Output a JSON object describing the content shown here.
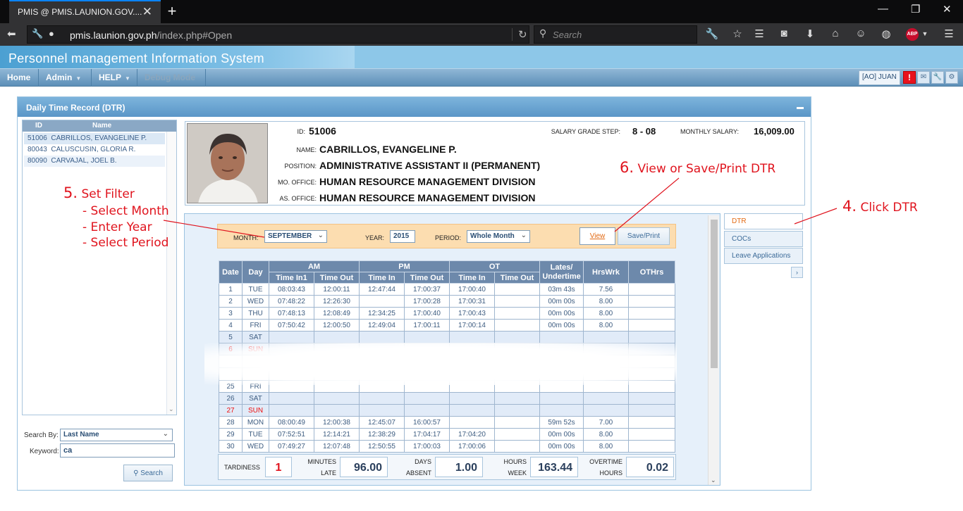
{
  "browser": {
    "tab_title": "PMIS @ PMIS.LAUNION.GOV....",
    "url_host": "pmis.launion.gov.ph",
    "url_path": "/index.php#Open",
    "search_placeholder": "Search",
    "abp_label": "ABP"
  },
  "app": {
    "title": "Personnel management Information System",
    "menu": [
      {
        "label": "Home"
      },
      {
        "label": "Admin"
      },
      {
        "label": "HELP"
      },
      {
        "label": "Debug Mode"
      }
    ],
    "user": "[AO] JUAN",
    "alert": "!"
  },
  "panel": {
    "title": "Daily Time Record (DTR)"
  },
  "employee_list": {
    "headers": {
      "id": "ID",
      "name": "Name"
    },
    "rows": [
      {
        "id": "51006",
        "name": "CABRILLOS, EVANGELINE P."
      },
      {
        "id": "80043",
        "name": "CALUSCUSIN, GLORIA R."
      },
      {
        "id": "80090",
        "name": "CARVAJAL, JOEL B."
      }
    ]
  },
  "search": {
    "by_label": "Search By:",
    "by_value": "Last Name",
    "keyword_label": "Keyword:",
    "keyword_value": "ca",
    "button": "Search"
  },
  "employee": {
    "id_label": "ID:",
    "id": "51006",
    "sg_label": "SALARY GRADE STEP:",
    "sg": "8 - 08",
    "salary_label": "MONTHLY SALARY:",
    "salary": "16,009.00",
    "name_label": "NAME:",
    "name": "CABRILLOS, EVANGELINE P.",
    "position_label": "POSITION:",
    "position": "ADMINISTRATIVE ASSISTANT II (PERMANENT)",
    "mo_label": "MO. OFFICE:",
    "mo_office": "HUMAN RESOURCE MANAGEMENT DIVISION",
    "as_label": "AS. OFFICE:",
    "as_office": "HUMAN RESOURCE MANAGEMENT DIVISION"
  },
  "filter": {
    "month_label": "MONTH:",
    "month": "SEPTEMBER",
    "year_label": "YEAR:",
    "year": "2015",
    "period_label": "PERIOD:",
    "period": "Whole Month",
    "view_button": "View",
    "save_button": "Save/Print"
  },
  "side_tabs": [
    {
      "label": "DTR"
    },
    {
      "label": "COCs"
    },
    {
      "label": "Leave Applications"
    }
  ],
  "side_more": "›",
  "table": {
    "h_date": "Date",
    "h_day": "Day",
    "h_am": "AM",
    "h_pm": "PM",
    "h_ot": "OT",
    "h_lates": "Lates/ Undertime",
    "h_hrs": "HrsWrk",
    "h_ot_hrs": "OTHrs",
    "h_in1": "Time In1",
    "h_out1": "Time Out",
    "h_in2": "Time In",
    "h_out2": "Time Out",
    "h_in3": "Time In",
    "h_out3": "Time Out",
    "rows": [
      {
        "d": "1",
        "day": "TUE",
        "c": [
          "08:03:43",
          "12:00:11",
          "12:47:44",
          "17:00:37",
          "17:00:40",
          "",
          "03m 43s",
          "7.56",
          ""
        ]
      },
      {
        "d": "2",
        "day": "WED",
        "c": [
          "07:48:22",
          "12:26:30",
          "",
          "17:00:28",
          "17:00:31",
          "",
          "00m 00s",
          "8.00",
          ""
        ]
      },
      {
        "d": "3",
        "day": "THU",
        "c": [
          "07:48:13",
          "12:08:49",
          "12:34:25",
          "17:00:40",
          "17:00:43",
          "",
          "00m 00s",
          "8.00",
          ""
        ]
      },
      {
        "d": "4",
        "day": "FRI",
        "c": [
          "07:50:42",
          "12:00:50",
          "12:49:04",
          "17:00:11",
          "17:00:14",
          "",
          "00m 00s",
          "8.00",
          ""
        ]
      },
      {
        "d": "5",
        "day": "SAT",
        "c": [
          "",
          "",
          "",
          "",
          "",
          "",
          "",
          "",
          ""
        ]
      },
      {
        "d": "6",
        "day": "SUN",
        "c": [
          "",
          "",
          "",
          "",
          "",
          "",
          "",
          "",
          ""
        ]
      },
      {
        "d": "",
        "day": "",
        "c": [
          "",
          "",
          "",
          "",
          "",
          "",
          "",
          "",
          ""
        ]
      },
      {
        "d": "",
        "day": "",
        "c": [
          "",
          "",
          "",
          "",
          "",
          "",
          "",
          "",
          ""
        ]
      },
      {
        "d": "25",
        "day": "FRI",
        "c": [
          "",
          "",
          "",
          "",
          "",
          "",
          "",
          "",
          ""
        ]
      },
      {
        "d": "26",
        "day": "SAT",
        "c": [
          "",
          "",
          "",
          "",
          "",
          "",
          "",
          "",
          ""
        ]
      },
      {
        "d": "27",
        "day": "SUN",
        "c": [
          "",
          "",
          "",
          "",
          "",
          "",
          "",
          "",
          ""
        ]
      },
      {
        "d": "28",
        "day": "MON",
        "c": [
          "08:00:49",
          "12:00:38",
          "12:45:07",
          "16:00:57",
          "",
          "",
          "59m 52s",
          "7.00",
          ""
        ]
      },
      {
        "d": "29",
        "day": "TUE",
        "c": [
          "07:52:51",
          "12:14:21",
          "12:38:29",
          "17:04:17",
          "17:04:20",
          "",
          "00m 00s",
          "8.00",
          ""
        ]
      },
      {
        "d": "30",
        "day": "WED",
        "c": [
          "07:49:27",
          "12:07:48",
          "12:50:55",
          "17:00:03",
          "17:00:06",
          "",
          "00m 00s",
          "8.00",
          ""
        ]
      }
    ]
  },
  "summary": {
    "tardiness_label": "TARDINESS",
    "tardiness": "1",
    "minutes_label_1": "MINUTES",
    "minutes_label_2": "LATE",
    "minutes": "96.00",
    "days_label_1": "DAYS",
    "days_label_2": "ABSENT",
    "days": "1.00",
    "hours_label_1": "HOURS",
    "hours_label_2": "WEEK",
    "hours": "163.44",
    "ot_label_1": "OVERTIME",
    "ot_label_2": "HOURS",
    "ot": "0.02"
  },
  "annotations": {
    "a4_num": "4.",
    "a4_text": "Click DTR",
    "a5_num": "5.",
    "a5_text": "Set Filter",
    "a5_l1": "- Select Month",
    "a5_l2": "- Enter Year",
    "a5_l3": "- Select Period",
    "a6_num": "6.",
    "a6_text": "View or Save/Print DTR"
  },
  "colors": {
    "accent": "#5a96c7",
    "annotation": "#e0141e",
    "filter_bg": "#fcddb0",
    "table_header": "#6d89ab"
  }
}
